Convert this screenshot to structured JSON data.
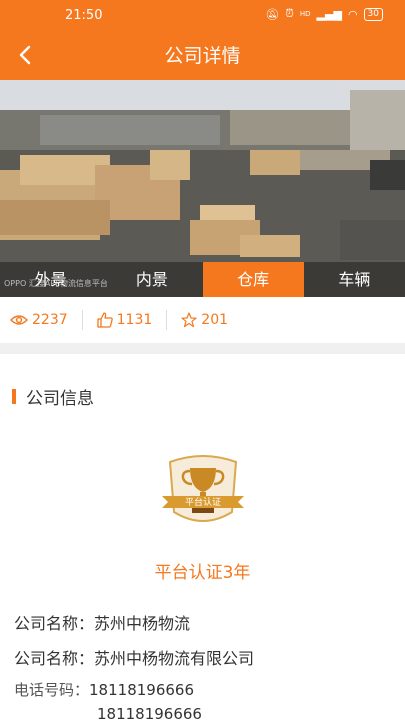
{
  "status_bar": {
    "time": "21:50",
    "signal_text": "HD",
    "battery": "30"
  },
  "nav": {
    "title": "公司详情"
  },
  "photo": {
    "watermark": "OPPO  汇搜APP物流信息平台"
  },
  "tabs": [
    {
      "label": "外景"
    },
    {
      "label": "内景"
    },
    {
      "label": "仓库"
    },
    {
      "label": "车辆"
    }
  ],
  "active_tab": 2,
  "stats": {
    "views": "2237",
    "likes": "1131",
    "favorites": "201"
  },
  "section": {
    "title": "公司信息"
  },
  "badge": {
    "text": "平台认证"
  },
  "certification": {
    "text": "平台认证3年"
  },
  "company": {
    "name_label": "公司名称：",
    "name_value": "苏州中杨物流",
    "full_name_label": "公司名称：",
    "full_name_value": "苏州中杨物流有限公司",
    "phone_label": "电话号码：",
    "phones": [
      "18118196666",
      "18118196666"
    ]
  },
  "colors": {
    "accent": "#f5781e",
    "background": "#ffffff",
    "band": "#f0f0f0"
  }
}
